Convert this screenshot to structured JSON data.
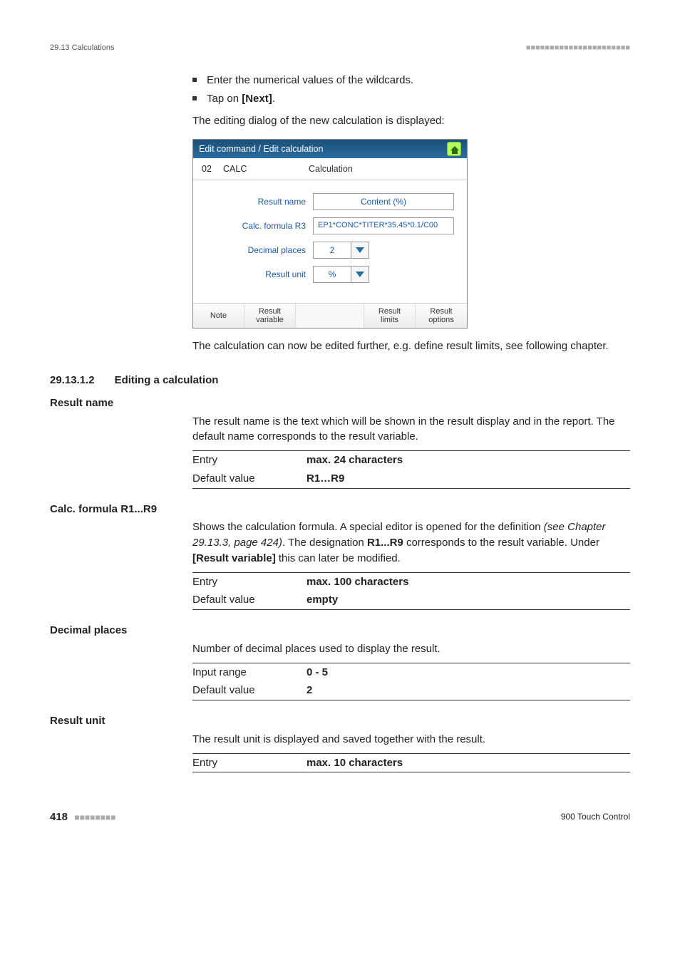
{
  "header": {
    "breadcrumb": "29.13 Calculations",
    "dashes": "■■■■■■■■■■■■■■■■■■■■■■"
  },
  "intro": {
    "bullet1": "Enter the numerical values of the wildcards.",
    "bullet2_pre": "Tap on ",
    "bullet2_bold": "[Next]",
    "bullet2_post": ".",
    "caption": "The editing dialog of the new calculation is displayed:"
  },
  "dialog": {
    "title": "Edit command / Edit calculation",
    "idnum": "02",
    "idcmd": "CALC",
    "idlbl": "Calculation",
    "rows": {
      "result_name_label": "Result name",
      "result_name_value": "Content (%)",
      "calc_formula_label": "Calc. formula R3",
      "calc_formula_value": "EP1*CONC*TITER*35.45*0.1/C00",
      "dec_places_label": "Decimal places",
      "dec_places_value": "2",
      "result_unit_label": "Result unit",
      "result_unit_value": "%"
    },
    "footer": {
      "note": "Note",
      "resvar": "Result\nvariable",
      "reslim": "Result\nlimits",
      "resopt": "Result\noptions"
    }
  },
  "after_shot": "The calculation can now be edited further, e.g. define result limits, see following chapter.",
  "section": {
    "num": "29.13.1.2",
    "title": "Editing a calculation"
  },
  "params": {
    "result_name": {
      "name": "Result name",
      "desc": "The result name is the text which will be shown in the result display and in the report. The default name corresponds to the result variable.",
      "entry_label": "Entry",
      "entry_value": "max. 24 characters",
      "default_label": "Default value",
      "default_value": "R1…R9"
    },
    "calc_formula": {
      "name": "Calc. formula R1...R9",
      "desc_pre": "Shows the calculation formula. A special editor is opened for the definition ",
      "desc_it": "(see Chapter 29.13.3, page 424)",
      "desc_mid1": ". The designation ",
      "desc_b1": "R1...R9",
      "desc_mid2": " corresponds to the result variable. Under ",
      "desc_b2": "[Result variable]",
      "desc_post": " this can later be modified.",
      "entry_label": "Entry",
      "entry_value": "max. 100 characters",
      "default_label": "Default value",
      "default_value": "empty"
    },
    "decimal_places": {
      "name": "Decimal places",
      "desc": "Number of decimal places used to display the result.",
      "range_label": "Input range",
      "range_value": "0 - 5",
      "default_label": "Default value",
      "default_value": "2"
    },
    "result_unit": {
      "name": "Result unit",
      "desc": "The result unit is displayed and saved together with the result.",
      "entry_label": "Entry",
      "entry_value": "max. 10 characters"
    }
  },
  "footer": {
    "page": "418",
    "dashes": "■■■■■■■■",
    "product": "900 Touch Control"
  }
}
